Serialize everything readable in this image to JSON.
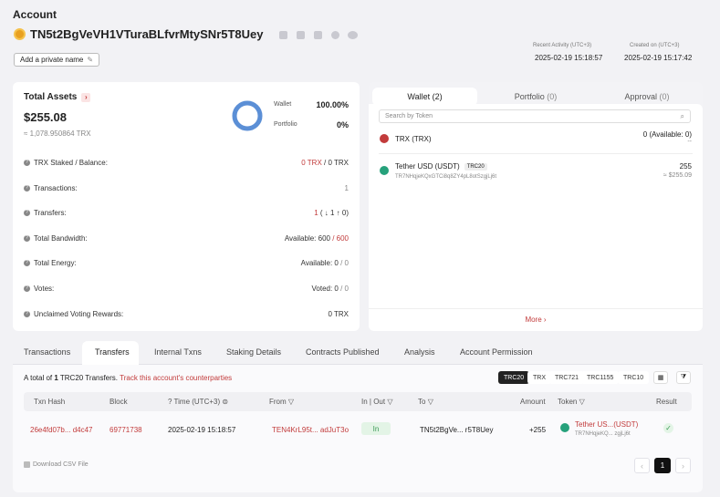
{
  "header": {
    "title": "Account",
    "address": "TN5t2BgVeVH1VTuraBLfvrMtySNr5T8Uey",
    "private_name_button": "Add a private name",
    "recent_activity_label": "Recent Activity (UTC+3)",
    "recent_activity_value": "2025-02-19 15:18:57",
    "created_label": "Created on (UTC+3)",
    "created_value": "2025-02-19 15:17:42"
  },
  "assets": {
    "title": "Total Assets",
    "total_usd": "$255.08",
    "total_trx": "≈ 1,078.950864 TRX",
    "legend": [
      {
        "label": "Wallet",
        "value": "100.00%"
      },
      {
        "label": "Portfolio",
        "value": "0%"
      }
    ],
    "donut": {
      "wallet_fraction": 1.0,
      "color": "#5b8fd6"
    },
    "rows": [
      {
        "label": "TRX Staked / Balance:",
        "v1": "0 TRX",
        "v2": " / 0 TRX"
      },
      {
        "label": "Transactions:",
        "v1": "1",
        "v2": ""
      },
      {
        "label": "Transfers:",
        "v1": "1",
        "v2": "( ↓ 1  ↑ 0)"
      },
      {
        "label": "Total Bandwidth:",
        "v1": "Available: 600",
        "v2": " / 600"
      },
      {
        "label": "Total Energy:",
        "v1": "Available: 0",
        "v2": " / 0"
      },
      {
        "label": "Votes:",
        "v1": "Voted: 0",
        "v2": " / 0"
      },
      {
        "label": "Unclaimed Voting Rewards:",
        "v1": "0 TRX",
        "v2": ""
      }
    ]
  },
  "wallet_panel": {
    "tabs": [
      {
        "label": "Wallet",
        "count": "(2)"
      },
      {
        "label": "Portfolio",
        "count": "(0)"
      },
      {
        "label": "Approval",
        "count": "(0)"
      }
    ],
    "search_placeholder": "Search by Token",
    "tokens": [
      {
        "name": "TRX (TRX)",
        "badge": "",
        "contract": "",
        "amount": "0 (Available: 0)",
        "usd": "--"
      },
      {
        "name": "Tether USD (USDT)",
        "badge": "TRC20",
        "contract": "TR7NHqjeKQxGTCi8q8ZY4pL8otSzgjLj6t",
        "amount": "255",
        "usd": "≈ $255.09"
      }
    ],
    "more": "More"
  },
  "main_tabs": [
    "Transactions",
    "Transfers",
    "Internal Txns",
    "Staking Details",
    "Contracts Published",
    "Analysis",
    "Account Permission"
  ],
  "transfers": {
    "summary_prefix": "A total of ",
    "summary_count": "1",
    "summary_suffix": " TRC20 Transfers.",
    "track_link": "Track this account's counterparties",
    "filters": [
      "TRC20",
      "TRX",
      "TRC721",
      "TRC1155",
      "TRC10"
    ],
    "columns": [
      "Txn Hash",
      "Block",
      "Time (UTC+3)",
      "From",
      "In | Out",
      "To",
      "Amount",
      "Token",
      "Result"
    ],
    "rows": [
      {
        "hash": "26e4fd07b... d4c47",
        "block": "69771738",
        "time": "2025-02-19 15:18:57",
        "from": "TEN4KrL95t... adJuT3o",
        "direction": "In",
        "to": "TN5t2BgVe... r5T8Uey",
        "amount": "+255",
        "token": "Tether US...(USDT)",
        "token_addr": "TR7NHqjeKQ... zgjLj6t"
      }
    ],
    "download": "Download CSV File",
    "page": "1"
  }
}
